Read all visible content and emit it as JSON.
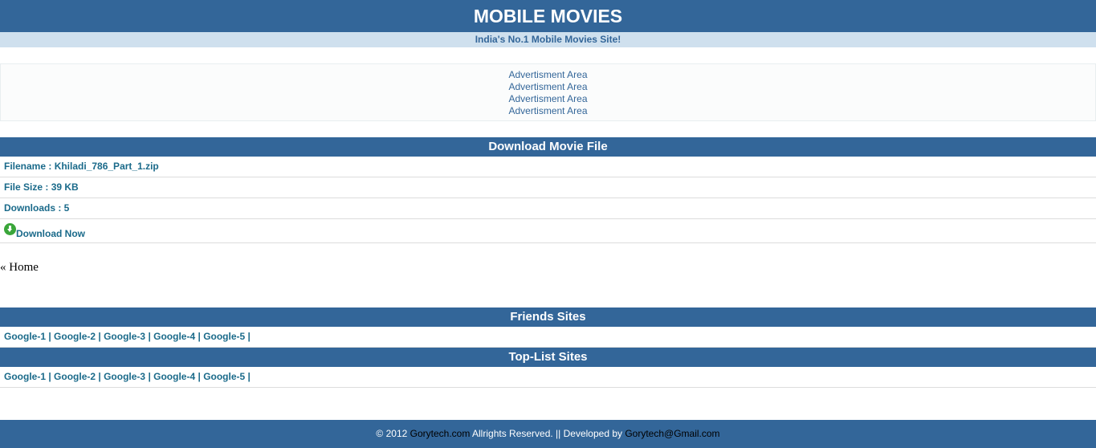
{
  "header": {
    "title": "MOBILE MOVIES",
    "tagline": "India's No.1 Mobile Movies Site!"
  },
  "ads": {
    "lines": [
      "Advertisment Area",
      "Advertisment Area",
      "Advertisment Area",
      "Advertisment Area"
    ]
  },
  "download": {
    "heading": "Download Movie File",
    "filename_label": "Filename : ",
    "filename_value": "Khiladi_786_Part_1.zip",
    "filesize_label": "File Size : ",
    "filesize_value": "39 KB",
    "downloads_label": "Downloads : ",
    "downloads_value": "5",
    "download_now": "Download Now",
    "download_icon": "download-arrow-icon"
  },
  "nav": {
    "home_text": "« Home"
  },
  "friends": {
    "heading": "Friends Sites",
    "links": [
      "Google-1",
      "Google-2",
      "Google-3",
      "Google-4",
      "Google-5"
    ]
  },
  "toplist": {
    "heading": "Top-List Sites",
    "links": [
      "Google-1",
      "Google-2",
      "Google-3",
      "Google-4",
      "Google-5"
    ]
  },
  "footer": {
    "prefix": "© 2012 ",
    "site": "Gorytech.com",
    "middle": " Allrights Reserved. || Developed by ",
    "email": "Gorytech@Gmail.com"
  },
  "colors": {
    "primary": "#336699",
    "tagline_bg": "#cfe0ee",
    "link": "#1a6a8a",
    "icon_green": "#3aa63a"
  }
}
